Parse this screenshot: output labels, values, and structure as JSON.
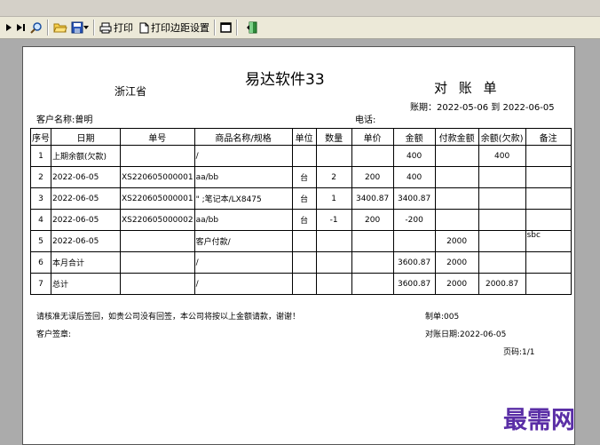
{
  "toolbar": {
    "print_label": "打印",
    "margin_label": "打印边距设置"
  },
  "report": {
    "title": "易达软件33",
    "province": "浙江省",
    "doc_type": "对 账 单",
    "period": "账期：2022-05-06 到 2022-06-05",
    "customer": "客户名称:曾明",
    "phone": "电话:",
    "columns": [
      "序号",
      "日期",
      "单号",
      "商品名称/规格",
      "单位",
      "数量",
      "单价",
      "金额",
      "付款金额",
      "余额(欠款)",
      "备注"
    ],
    "rows": [
      [
        "1",
        "上期余额(欠款)",
        "",
        "/",
        "",
        "",
        "",
        "400",
        "",
        "400",
        ""
      ],
      [
        "2",
        "2022-06-05",
        "XS220605000001",
        "aa/bb",
        "台",
        "2",
        "200",
        "400",
        "",
        "",
        ""
      ],
      [
        "3",
        "2022-06-05",
        "XS220605000001",
        "\" ;笔记本/LX8475",
        "台",
        "1",
        "3400.87",
        "3400.87",
        "",
        "",
        ""
      ],
      [
        "4",
        "2022-06-05",
        "XS220605000002",
        "aa/bb",
        "台",
        "-1",
        "200",
        "-200",
        "",
        "",
        ""
      ],
      [
        "5",
        "2022-06-05",
        "",
        "客户付款/",
        "",
        "",
        "",
        "",
        "2000",
        "",
        "sbc"
      ],
      [
        "6",
        "本月合计",
        "",
        "/",
        "",
        "",
        "",
        "3600.87",
        "2000",
        "",
        ""
      ],
      [
        "7",
        "总计",
        "",
        "/",
        "",
        "",
        "",
        "3600.87",
        "2000",
        "2000.87",
        ""
      ]
    ],
    "footer_note": "请核准无误后签回，如贵公司没有回签，本公司将按以上金额请款，谢谢！",
    "signature": "客户签章:",
    "maker": "制单:005",
    "statement_date": "对账日期:2022-06-05",
    "page_no": "页码:1/1"
  },
  "watermark": "最需网"
}
